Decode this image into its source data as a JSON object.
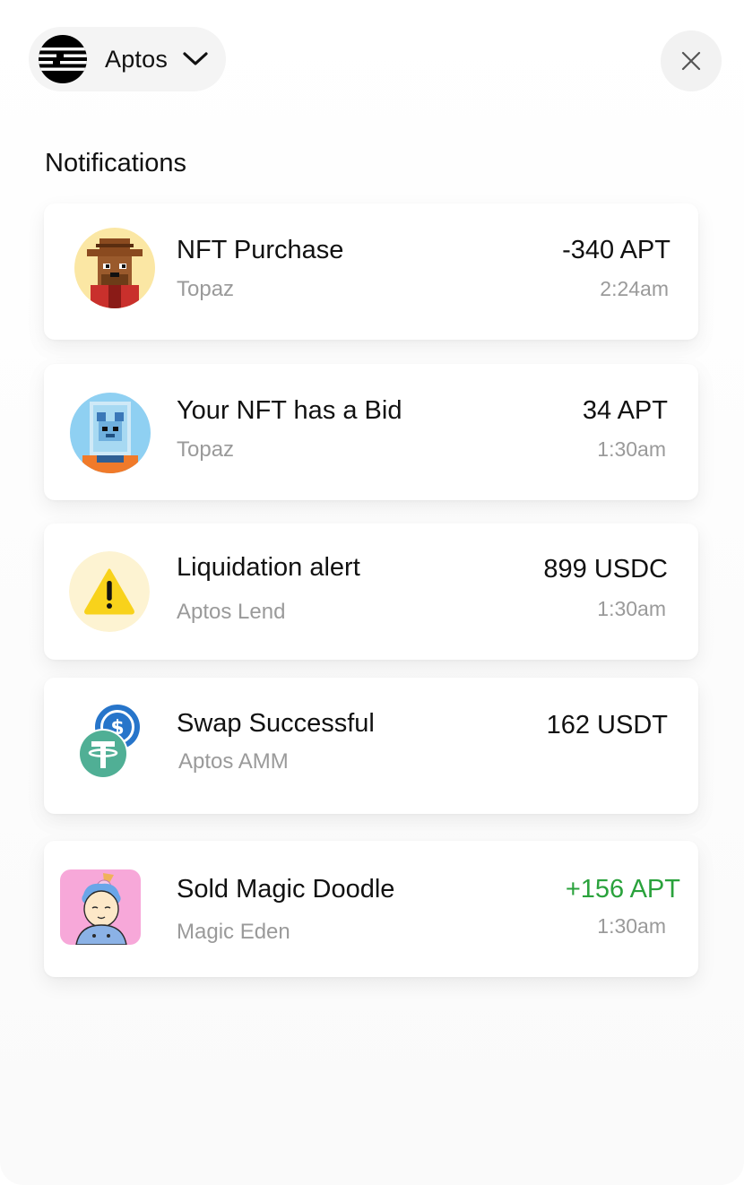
{
  "header": {
    "network_name": "Aptos",
    "network_icon": "aptos-logo-icon",
    "close_icon": "close-icon"
  },
  "notifications": {
    "title": "Notifications",
    "items": [
      {
        "title": "NFT Purchase",
        "source": "Topaz",
        "amount": "-340 APT",
        "time": "2:24am",
        "icon": "nft-avatar-icon"
      },
      {
        "title": "Your NFT has a Bid",
        "source": "Topaz",
        "amount": "34 APT",
        "time": "1:30am",
        "icon": "nft-avatar-icon"
      },
      {
        "title": "Liquidation alert",
        "source": "Aptos Lend",
        "amount": "899 USDC",
        "time": "1:30am",
        "icon": "warning-icon"
      },
      {
        "title": "Swap Successful",
        "source": "Aptos AMM",
        "amount": "162 USDT",
        "time": "",
        "icon": "swap-tokens-icon"
      },
      {
        "title": "Sold Magic Doodle",
        "source": "Magic Eden",
        "amount": "+156 APT",
        "time": "1:30am",
        "icon": "nft-avatar-icon"
      }
    ]
  },
  "colors": {
    "positive": "#2aa23c",
    "usdc": "#2775ca",
    "usdt": "#50af95",
    "warning": "#f8d21b"
  }
}
